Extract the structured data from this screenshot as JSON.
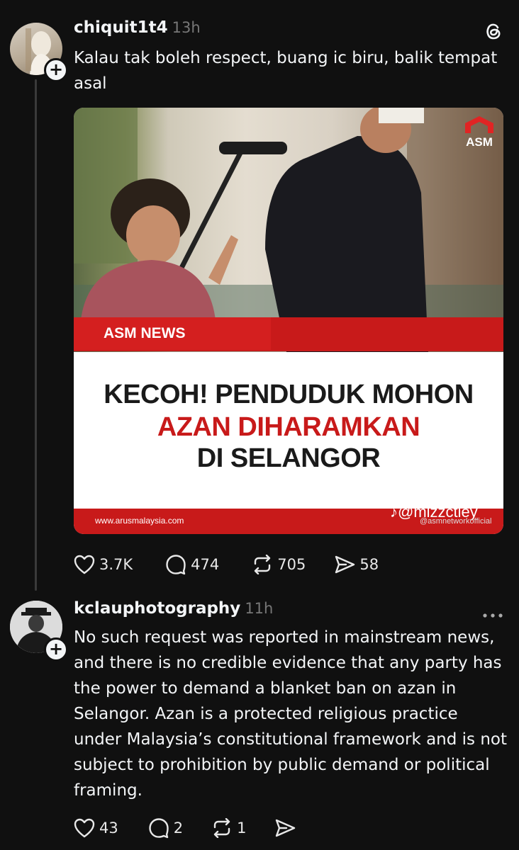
{
  "post": {
    "username": "chiquit1t4",
    "time": "13h",
    "text": "Kalau tak boleh respect, buang ic biru, balik tempat asal",
    "media": {
      "logo_text": "ASM",
      "tag": "ASM NEWS",
      "headline_line1": "KECOH! PENDUDUK MOHON",
      "headline_line2": "AZAN DIHARAMKAN",
      "headline_line3": "DI SELANGOR",
      "url": "www.arusmalaysia.com",
      "watermark": "@mizzctiey",
      "watermark2": "@asmnetworkofficial"
    },
    "likes": "3.7K",
    "replies": "474",
    "reposts": "705",
    "shares": "58"
  },
  "reply": {
    "username": "kclauphotography",
    "time": "11h",
    "text": "No such request was reported in mainstream news, and there is no credible evidence that any party has the power to demand a blanket ban on azan in Selangor. Azan is a protected religious practice under Malaysia’s constitutional framework and is not subject to prohibition by public demand or political framing.",
    "likes": "43",
    "replies": "2",
    "reposts": "1"
  },
  "colors": {
    "background": "#101010",
    "text": "#f3f5f7",
    "muted": "#777777",
    "news_red": "#c81a1a"
  }
}
